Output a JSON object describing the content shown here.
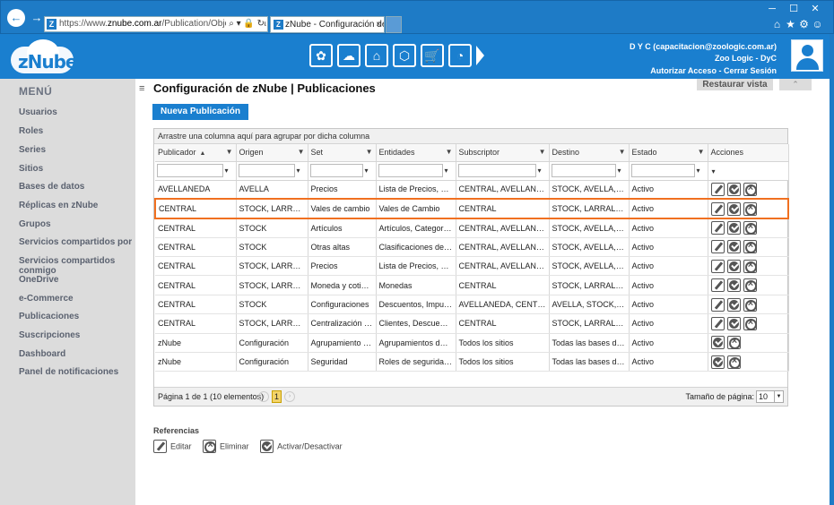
{
  "browser": {
    "url_prefix": "https://www.",
    "url_host": "znube.com.ar",
    "url_path": "/Publication/ObjectPublica",
    "url_tools": "⌕ ▾ 🔒 ↻",
    "tab_title": "zNube - Configuración de z...",
    "favicon_letter": "Z",
    "tab_close": "×"
  },
  "window_controls": [
    "─",
    "☐",
    "✕"
  ],
  "toolbar_icons": [
    "⌂",
    "★",
    "⚙",
    "☺"
  ],
  "header": {
    "logo_text": "zNube",
    "module_icons": [
      "✿",
      "☁",
      "⌂",
      "⬡",
      "🛒",
      "◔"
    ],
    "user_line1": "D Y C (capacitacion@zoologic.com.ar)",
    "user_line2": "Zoo Logic - DyC",
    "link_access": "Autorizar Acceso",
    "link_separator": "-",
    "link_logout": "Cerrar Sesión"
  },
  "sidebar": {
    "title": "MENÚ",
    "items": [
      "Usuarios",
      "Roles",
      "Series",
      "Sitios",
      "Bases de datos",
      "Réplicas en zNube",
      "Grupos",
      "Servicios compartidos por mí",
      "Servicios compartidos conmigo",
      "OneDrive",
      "e-Commerce",
      "Publicaciones",
      "Suscripciones",
      "Dashboard",
      "Panel de notificaciones"
    ]
  },
  "main": {
    "hamburger": "≡",
    "title": "Configuración de zNube | Publicaciones",
    "restore_view": "Restaurar vista",
    "collapse_caret": "⌃",
    "new_button": "Nueva Publicación",
    "group_hint": "Arrastre una columna aquí para agrupar por dicha columna",
    "filter_icon": "▼",
    "filter_funnel": "▾",
    "sort_icon": "▲",
    "columns": [
      "Publicador",
      "Origen",
      "Set",
      "Entidades",
      "Subscriptor",
      "Destino",
      "Estado",
      "Acciones"
    ],
    "rows": [
      {
        "publicador": "AVELLANEDA",
        "origen": "AVELLA",
        "set": "Precios",
        "entidades": "Lista de Precios, Pre...",
        "subscriptor": "CENTRAL, AVELLANEDA,...",
        "destino": "STOCK, AVELLA, LA...",
        "estado": "Activo",
        "editable": true,
        "selected": false
      },
      {
        "publicador": "CENTRAL",
        "origen": "STOCK, LARRALDE",
        "set": "Vales de cambio",
        "entidades": "Vales de Cambio",
        "subscriptor": "CENTRAL",
        "destino": "STOCK, LARRALDE",
        "estado": "Activo",
        "editable": true,
        "selected": true
      },
      {
        "publicador": "CENTRAL",
        "origen": "STOCK",
        "set": "Artículos",
        "entidades": "Artículos, Categorías...",
        "subscriptor": "CENTRAL, AVELLANEDA,...",
        "destino": "STOCK, AVELLA, LA...",
        "estado": "Activo",
        "editable": true,
        "selected": false
      },
      {
        "publicador": "CENTRAL",
        "origen": "STOCK",
        "set": "Otras altas",
        "entidades": "Clasificaciones de ve...",
        "subscriptor": "CENTRAL, AVELLANEDA,...",
        "destino": "STOCK, AVELLA, LA...",
        "estado": "Activo",
        "editable": true,
        "selected": false
      },
      {
        "publicador": "CENTRAL",
        "origen": "STOCK, LARRALDE",
        "set": "Precios",
        "entidades": "Lista de Precios, Pre...",
        "subscriptor": "CENTRAL, AVELLANEDA,...",
        "destino": "STOCK, AVELLA, LA...",
        "estado": "Activo",
        "editable": true,
        "selected": false
      },
      {
        "publicador": "CENTRAL",
        "origen": "STOCK, LARRALDE",
        "set": "Moneda y cotiza...",
        "entidades": "Monedas",
        "subscriptor": "CENTRAL",
        "destino": "STOCK, LARRALDE",
        "estado": "Activo",
        "editable": true,
        "selected": false
      },
      {
        "publicador": "CENTRAL",
        "origen": "STOCK",
        "set": "Configuraciones",
        "entidades": "Descuentos, Impues...",
        "subscriptor": "AVELLANEDA, CENTRAL,...",
        "destino": "AVELLA, STOCK, LARRALDE,...",
        "estado": "Activo",
        "editable": true,
        "selected": false
      },
      {
        "publicador": "CENTRAL",
        "origen": "STOCK, LARRALDE",
        "set": "Centralización de...",
        "entidades": "Clientes, Descuentos...",
        "subscriptor": "CENTRAL",
        "destino": "STOCK, LARRALDE",
        "estado": "Activo",
        "editable": true,
        "selected": false
      },
      {
        "publicador": "zNube",
        "origen": "Configuración",
        "set": "Agrupamiento de...",
        "entidades": "Agrupamientos de b...",
        "subscriptor": "Todos los sitios",
        "destino": "Todas las bases de d...",
        "estado": "Activo",
        "editable": false,
        "selected": false
      },
      {
        "publicador": "zNube",
        "origen": "Configuración",
        "set": "Seguridad",
        "entidades": "Roles de seguridad,...",
        "subscriptor": "Todos los sitios",
        "destino": "Todas las bases de d...",
        "estado": "Activo",
        "editable": false,
        "selected": false
      }
    ],
    "pager": {
      "info": "Página 1 de 1 (10 elementos)",
      "prev": "‹",
      "next": "›",
      "current_page": "1",
      "page_size_label": "Tamaño de página:",
      "page_size": "10",
      "page_size_dropdown": "▼"
    },
    "references": {
      "title": "Referencias",
      "edit": "Editar",
      "delete": "Eliminar",
      "toggle": "Activar/Desactivar"
    }
  },
  "colors": {
    "accent": "#1a7fcf",
    "selected_row_border": "#f07020",
    "sidebar_bg": "#dcdcdc"
  }
}
